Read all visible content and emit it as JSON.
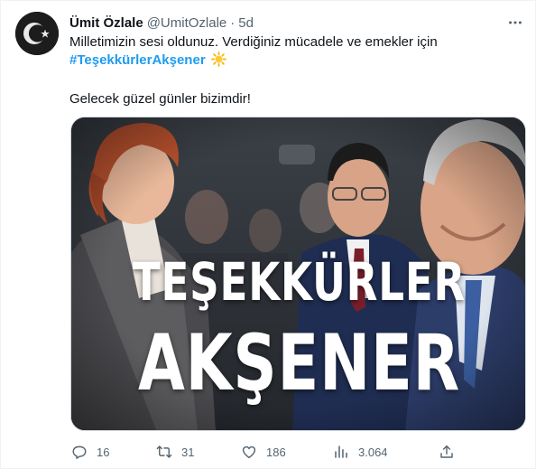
{
  "author": {
    "display_name": "Ümit Özlale",
    "handle": "@UmitOzlale",
    "separator": "·",
    "time": "5d",
    "avatar_icon": "crescent-star-icon"
  },
  "tweet": {
    "line1": "Milletimizin sesi oldunuz. Verdiğiniz mücadele ve emekler için",
    "hashtag": "#TeşekkürlerAkşener",
    "hashtag_emoji_icon": "sun-icon",
    "line3": "Gelecek güzel günler bizimdir!"
  },
  "media": {
    "overlay_line1": "TEŞEKKÜRLER",
    "overlay_line2": "AKŞENER"
  },
  "actions": {
    "replies": "16",
    "retweets": "31",
    "likes": "186",
    "views": "3.064"
  },
  "colors": {
    "accent": "#1d9bf0",
    "muted": "#536471",
    "text": "#0f1419"
  }
}
